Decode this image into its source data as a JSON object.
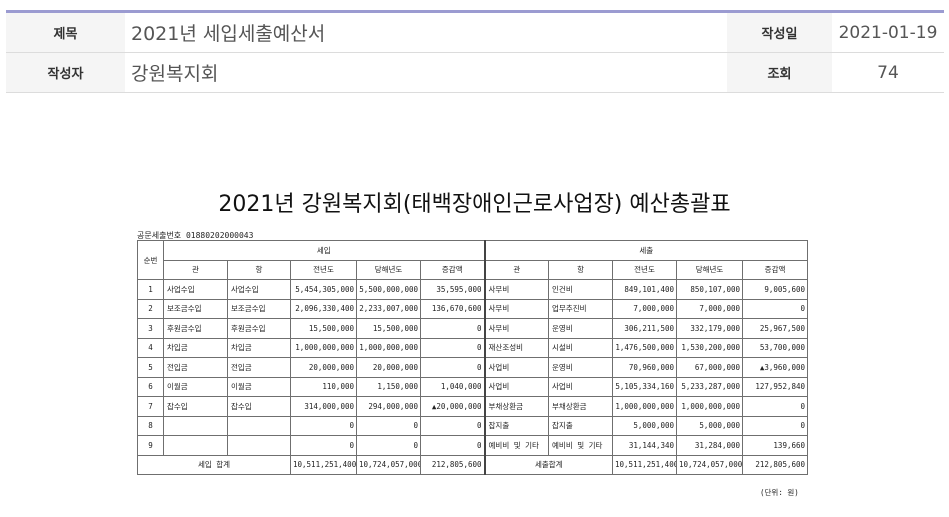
{
  "meta": {
    "title_label": "제목",
    "title_value": "2021년 세입세출예산서",
    "date_label": "작성일",
    "date_value": "2021-01-19",
    "author_label": "작성자",
    "author_value": "강원복지회",
    "views_label": "조회",
    "views_value": "74"
  },
  "document": {
    "title": "2021년 강원복지회(태백장애인근로사업장) 예산총괄표",
    "pub_no": "공문세출번호  01880202000043",
    "unit_note": "(단위: 원)",
    "headers": {
      "seq": "순번",
      "revenue": "세입",
      "expenditure": "세출",
      "gwan": "관",
      "hang": "항",
      "prev_year": "전년도",
      "this_year": "당해년도",
      "change": "증감액"
    },
    "rows": [
      {
        "no": "1",
        "r_gwan": "사업수입",
        "r_hang": "사업수입",
        "r_prev": "5,454,305,000",
        "r_cur": "5,500,000,000",
        "r_chg": "35,595,000",
        "e_gwan": "사무비",
        "e_hang": "인건비",
        "e_prev": "849,101,400",
        "e_cur": "850,107,000",
        "e_chg": "9,005,600"
      },
      {
        "no": "2",
        "r_gwan": "보조금수입",
        "r_hang": "보조금수입",
        "r_prev": "2,096,330,400",
        "r_cur": "2,233,007,000",
        "r_chg": "136,670,600",
        "e_gwan": "사무비",
        "e_hang": "업무추진비",
        "e_prev": "7,000,000",
        "e_cur": "7,000,000",
        "e_chg": "0"
      },
      {
        "no": "3",
        "r_gwan": "후원금수입",
        "r_hang": "후원금수입",
        "r_prev": "15,500,000",
        "r_cur": "15,500,000",
        "r_chg": "0",
        "e_gwan": "사무비",
        "e_hang": "운영비",
        "e_prev": "306,211,500",
        "e_cur": "332,179,000",
        "e_chg": "25,967,500"
      },
      {
        "no": "4",
        "r_gwan": "차입금",
        "r_hang": "차입금",
        "r_prev": "1,000,000,000",
        "r_cur": "1,000,000,000",
        "r_chg": "0",
        "e_gwan": "재산조성비",
        "e_hang": "시설비",
        "e_prev": "1,476,500,000",
        "e_cur": "1,530,200,000",
        "e_chg": "53,700,000"
      },
      {
        "no": "5",
        "r_gwan": "전입금",
        "r_hang": "전입금",
        "r_prev": "20,000,000",
        "r_cur": "20,000,000",
        "r_chg": "0",
        "e_gwan": "사업비",
        "e_hang": "운영비",
        "e_prev": "70,960,000",
        "e_cur": "67,000,000",
        "e_chg": "▲3,960,000"
      },
      {
        "no": "6",
        "r_gwan": "이월금",
        "r_hang": "이월금",
        "r_prev": "110,000",
        "r_cur": "1,150,000",
        "r_chg": "1,040,000",
        "e_gwan": "사업비",
        "e_hang": "사업비",
        "e_prev": "5,105,334,160",
        "e_cur": "5,233,287,000",
        "e_chg": "127,952,840"
      },
      {
        "no": "7",
        "r_gwan": "잡수입",
        "r_hang": "잡수입",
        "r_prev": "314,000,000",
        "r_cur": "294,000,000",
        "r_chg": "▲20,000,000",
        "e_gwan": "부채상환금",
        "e_hang": "부채상환금",
        "e_prev": "1,000,000,000",
        "e_cur": "1,000,000,000",
        "e_chg": "0"
      },
      {
        "no": "8",
        "r_gwan": "",
        "r_hang": "",
        "r_prev": "0",
        "r_cur": "0",
        "r_chg": "0",
        "e_gwan": "잡지출",
        "e_hang": "잡지출",
        "e_prev": "5,000,000",
        "e_cur": "5,000,000",
        "e_chg": "0"
      },
      {
        "no": "9",
        "r_gwan": "",
        "r_hang": "",
        "r_prev": "0",
        "r_cur": "0",
        "r_chg": "0",
        "e_gwan": "예비비 및 기타",
        "e_hang": "예비비 및 기타",
        "e_prev": "31,144,340",
        "e_cur": "31,284,000",
        "e_chg": "139,660"
      }
    ],
    "totals": {
      "r_label": "세입 합계",
      "r_prev": "10,511,251,400",
      "r_cur": "10,724,057,000",
      "r_chg": "212,805,600",
      "e_label": "세출합계",
      "e_prev": "10,511,251,400",
      "e_cur": "10,724,057,000",
      "e_chg": "212,805,600"
    }
  }
}
